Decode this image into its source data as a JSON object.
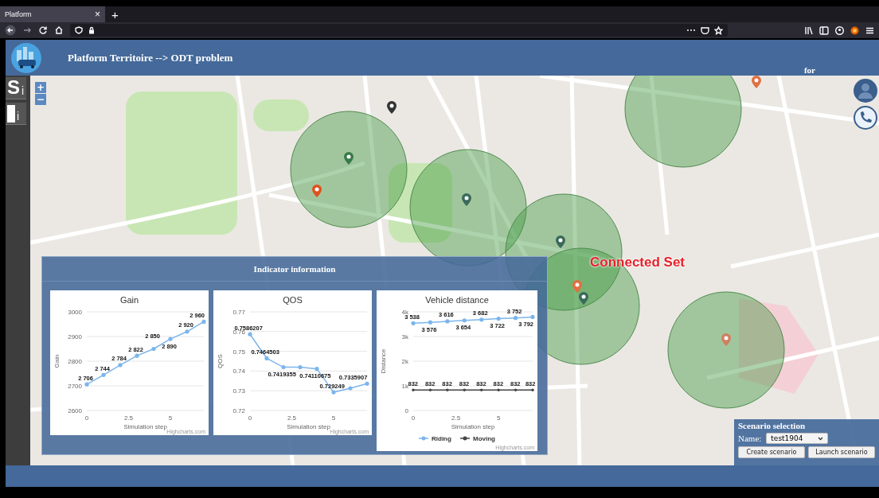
{
  "browser": {
    "tab_title": "Platform",
    "tab_close": "×",
    "new_tab": "+"
  },
  "header": {
    "title": "Platform Territoire --> ODT problem",
    "user_text": "for"
  },
  "sidebar": {
    "buttons": [
      {
        "kind": "letter",
        "label": "S",
        "sub": "i"
      },
      {
        "kind": "block",
        "sub": "i"
      }
    ]
  },
  "map": {
    "zoom_in": "+",
    "zoom_out": "−",
    "annotation": "Connected Set"
  },
  "indicator_panel": {
    "title": "Indicator information",
    "charts": [
      {
        "credit": "Highcharts.com",
        "chart_data": {
          "type": "line",
          "title": "Gain",
          "xlabel": "Simulation step",
          "ylabel": "Gain",
          "grid": true,
          "x": [
            0,
            1,
            2,
            3,
            4,
            5,
            6,
            7
          ],
          "xlim": [
            0,
            7
          ],
          "ylim": [
            2600,
            3000
          ],
          "xticks": [
            0,
            2.5,
            5
          ],
          "yticks": [
            2600,
            2700,
            2800,
            2900,
            3000
          ],
          "series": [
            {
              "color": "#7cb5ec",
              "values": [
                2706,
                2744,
                2784,
                2822,
                2850,
                2890,
                2920,
                2960
              ]
            }
          ],
          "value_labels": [
            [
              "2 706",
              "2 744",
              "2 784",
              "2 822",
              "2 850",
              "2 890",
              "2 920",
              "2 960"
            ]
          ]
        }
      },
      {
        "credit": "Highcharts.com",
        "chart_data": {
          "type": "line",
          "title": "QOS",
          "xlabel": "Simulation step",
          "ylabel": "QOS",
          "grid": true,
          "x": [
            0,
            1,
            2,
            3,
            4,
            5,
            6,
            7
          ],
          "xlim": [
            0,
            7
          ],
          "ylim": [
            0.72,
            0.77
          ],
          "xticks": [
            0,
            2.5,
            5
          ],
          "yticks": [
            0.72,
            0.73,
            0.74,
            0.75,
            0.76,
            0.77
          ],
          "series": [
            {
              "color": "#7cb5ec",
              "values": [
                0.7586207,
                0.7464503,
                0.7419355,
                0.7419355,
                0.74110675,
                0.729249,
                0.7313,
                0.7335907
              ]
            }
          ],
          "value_labels": [
            [
              "0.7586207",
              "0.7464503",
              "0.7419355",
              null,
              "0.74110675",
              "0.729249",
              null,
              "0.7335907"
            ]
          ]
        }
      },
      {
        "credit": "Highcharts.com",
        "chart_data": {
          "type": "line",
          "title": "Vehicle distance",
          "xlabel": "Simulation step",
          "ylabel": "Distance",
          "grid": true,
          "legend": true,
          "x": [
            0,
            1,
            2,
            3,
            4,
            5,
            6,
            7
          ],
          "xlim": [
            0,
            7
          ],
          "ylim": [
            0,
            4000
          ],
          "xticks": [
            0,
            2.5,
            5
          ],
          "yticks": [
            {
              "value": 0,
              "label": "0"
            },
            {
              "value": 1000,
              "label": "1k"
            },
            {
              "value": 2000,
              "label": "2k"
            },
            {
              "value": 3000,
              "label": "3k"
            },
            {
              "value": 4000,
              "label": "4k"
            }
          ],
          "series": [
            {
              "name": "Riding",
              "color": "#7cb5ec",
              "values": [
                3538,
                3576,
                3616,
                3654,
                3682,
                3722,
                3752,
                3792
              ]
            },
            {
              "name": "Moving",
              "color": "#434348",
              "values": [
                832,
                832,
                832,
                832,
                832,
                832,
                832,
                832
              ]
            }
          ],
          "value_labels": [
            [
              "3 538",
              "3 576",
              "3 616",
              "3 654",
              "3 682",
              "3 722",
              "3 752",
              "3 792"
            ],
            [
              "832",
              "832",
              "832",
              "832",
              "832",
              "832",
              "832",
              "832"
            ]
          ]
        }
      }
    ]
  },
  "scenario_panel": {
    "title": "Scenario selection",
    "name_label": "Name:",
    "selected_scenario": "test1904",
    "buttons": [
      "Create scenario",
      "Launch scenario"
    ]
  }
}
